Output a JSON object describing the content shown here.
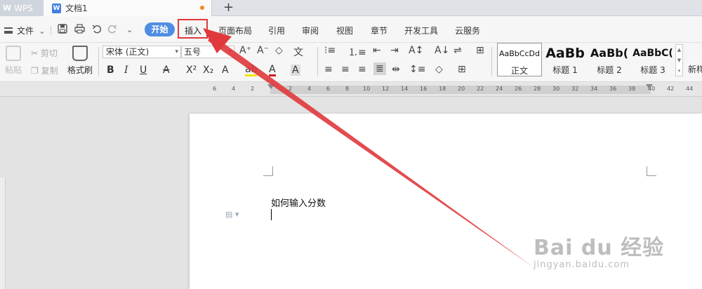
{
  "tabbar": {
    "app_tab": {
      "logo": "W",
      "label": "WPS"
    },
    "doc_tab": {
      "icon": "W",
      "label": "文档1"
    },
    "add_symbol": "+"
  },
  "menu": {
    "file": "文件",
    "file_arrow": "⌄",
    "quick_access": [
      "save-icon",
      "print-icon",
      "undo-icon",
      "redo-icon",
      "customize-icon"
    ],
    "start": "开始",
    "insert": "插入",
    "items": [
      "页面布局",
      "引用",
      "审阅",
      "视图",
      "章节",
      "开发工具",
      "云服务"
    ]
  },
  "ribbon": {
    "paste": "粘贴",
    "cut": "剪切",
    "copy": "复制",
    "format_painter": "格式刷",
    "font_name": "宋体 (正文)",
    "font_size": "五号",
    "styles": [
      {
        "sample": "AaBbCcDd",
        "name": "正文"
      },
      {
        "sample": "AaBb",
        "name": "标题 1"
      },
      {
        "sample": "AaBb(",
        "name": "标题 2"
      },
      {
        "sample": "AaBbC(",
        "name": "标题 3"
      }
    ],
    "new_style": "新样"
  },
  "ruler": {
    "labels": [
      "6",
      "4",
      "2",
      "2",
      "4",
      "6",
      "8",
      "10",
      "12",
      "14",
      "16",
      "18",
      "20",
      "22",
      "24",
      "26",
      "28",
      "30",
      "32",
      "34",
      "36",
      "38",
      "40",
      "42",
      "44"
    ]
  },
  "document": {
    "text": "如何输入分数"
  },
  "watermark": {
    "main": "Bai du 经验",
    "sub": "jingyan.baidu.com"
  },
  "colors": {
    "start_button": "#4f8de3",
    "highlight_box": "#e03a3a",
    "arrow": "#e0393c"
  }
}
